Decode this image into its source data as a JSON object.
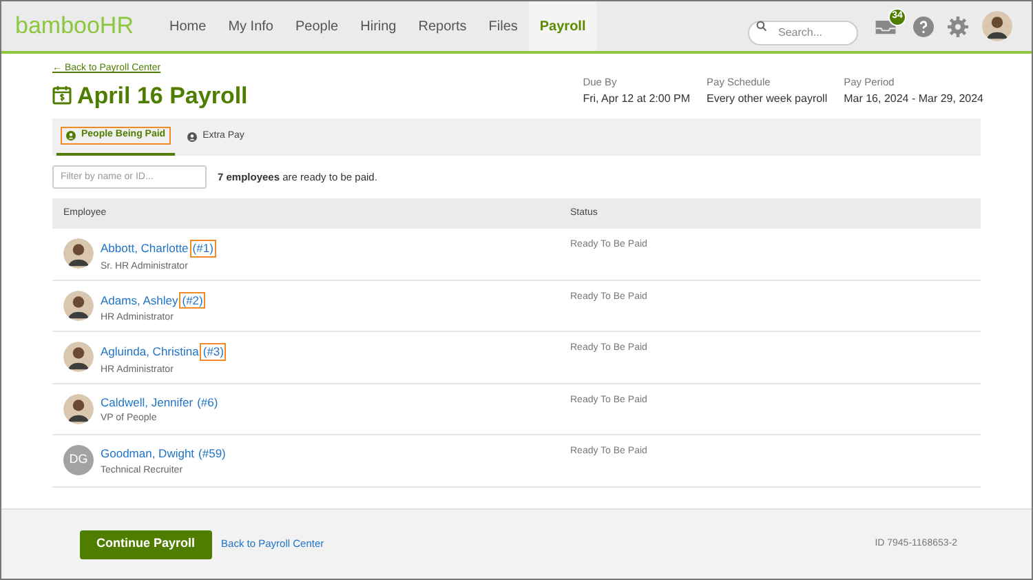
{
  "nav": {
    "logo": "bambooHR",
    "items": [
      {
        "label": "Home",
        "selected": false
      },
      {
        "label": "My Info",
        "selected": false
      },
      {
        "label": "People",
        "selected": false
      },
      {
        "label": "Hiring",
        "selected": false
      },
      {
        "label": "Reports",
        "selected": false
      },
      {
        "label": "Files",
        "selected": false
      },
      {
        "label": "Payroll",
        "selected": true
      }
    ],
    "search": {
      "placeholder": "Search..."
    },
    "inbox_badge": "34"
  },
  "back_link": "← Back to Payroll Center",
  "title": "April 16 Payroll",
  "summary": [
    {
      "label": "Due By",
      "value": "Fri, Apr 12 at 2:00 PM"
    },
    {
      "label": "Pay Schedule",
      "value": "Every other week payroll"
    },
    {
      "label": "Pay Period",
      "value": "Mar 16, 2024 - Mar 29, 2024"
    }
  ],
  "tabs": [
    {
      "label": "People Being Paid",
      "selected": true,
      "highlighted": true
    },
    {
      "label": "Extra Pay",
      "selected": false,
      "highlighted": false
    }
  ],
  "filter": {
    "placeholder": "Filter by name or ID..."
  },
  "ready_message": "**7 employees** are ready to be paid.",
  "table": {
    "columns": [
      "Employee",
      "Status"
    ],
    "rows": [
      {
        "avatar": {
          "kind": "photo"
        },
        "name": "Abbott, Charlotte",
        "id": "(#1)",
        "id_highlighted": true,
        "job": "Sr. HR Administrator",
        "status": "Ready To Be Paid"
      },
      {
        "avatar": {
          "kind": "photo"
        },
        "name": "Adams, Ashley",
        "id": "(#2)",
        "id_highlighted": true,
        "job": "HR Administrator",
        "status": "Ready To Be Paid"
      },
      {
        "avatar": {
          "kind": "photo"
        },
        "name": "Agluinda, Christina",
        "id": "(#3)",
        "id_highlighted": true,
        "job": "HR Administrator",
        "status": "Ready To Be Paid"
      },
      {
        "avatar": {
          "kind": "photo"
        },
        "name": "Caldwell, Jennifer",
        "id": "(#6)",
        "id_highlighted": false,
        "job": "VP of People",
        "status": "Ready To Be Paid"
      },
      {
        "avatar": {
          "kind": "initials",
          "initials": "DG"
        },
        "name": "Goodman, Dwight",
        "id": "(#59)",
        "id_highlighted": false,
        "job": "Technical Recruiter",
        "status": "Ready To Be Paid"
      }
    ]
  },
  "footer": {
    "primary_button": "Continue Payroll",
    "link": "Back to Payroll Center",
    "id_text": "ID 7945-1168653-2"
  }
}
